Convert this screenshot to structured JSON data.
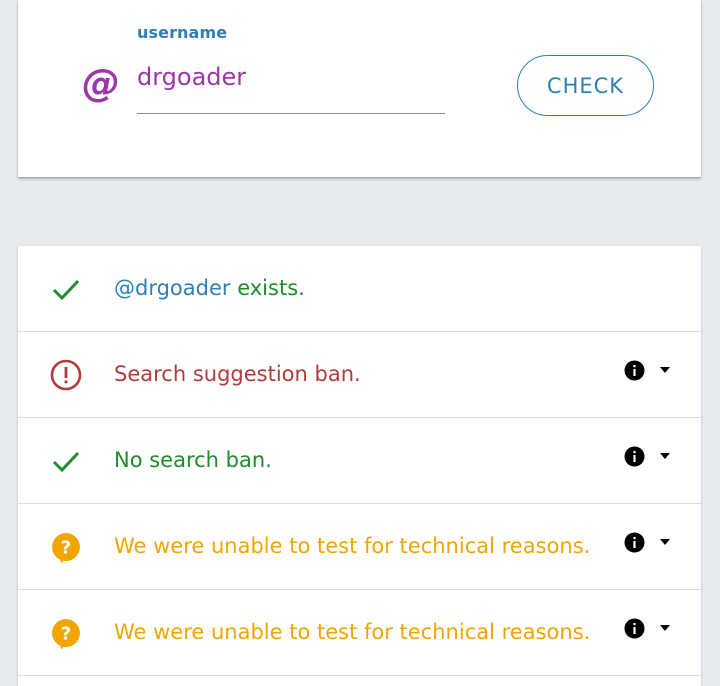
{
  "search": {
    "label": "username",
    "at_symbol": "@",
    "value": "drgoader",
    "button_label": "CHECK"
  },
  "results": [
    {
      "status": "ok",
      "icon": "check-icon",
      "handle": "@drgoader",
      "text": " exists.",
      "has_info": false
    },
    {
      "status": "ban",
      "icon": "alert-circle-icon",
      "text": "Search suggestion ban.",
      "has_info": true
    },
    {
      "status": "ok",
      "icon": "check-icon",
      "text": "No search ban.",
      "has_info": true
    },
    {
      "status": "unknown",
      "icon": "help-bubble-icon",
      "text": "We were unable to test for technical reasons.",
      "has_info": true
    },
    {
      "status": "unknown",
      "icon": "help-bubble-icon",
      "text": "We were unable to test for technical reasons.",
      "has_info": true
    }
  ],
  "colors": {
    "accent_blue": "#2f7fb6",
    "username_purple": "#9c37a8",
    "ok_green": "#1e8c2a",
    "ban_red": "#b23b3b",
    "unknown_orange": "#f0a500",
    "background": "#e8ecf0"
  }
}
